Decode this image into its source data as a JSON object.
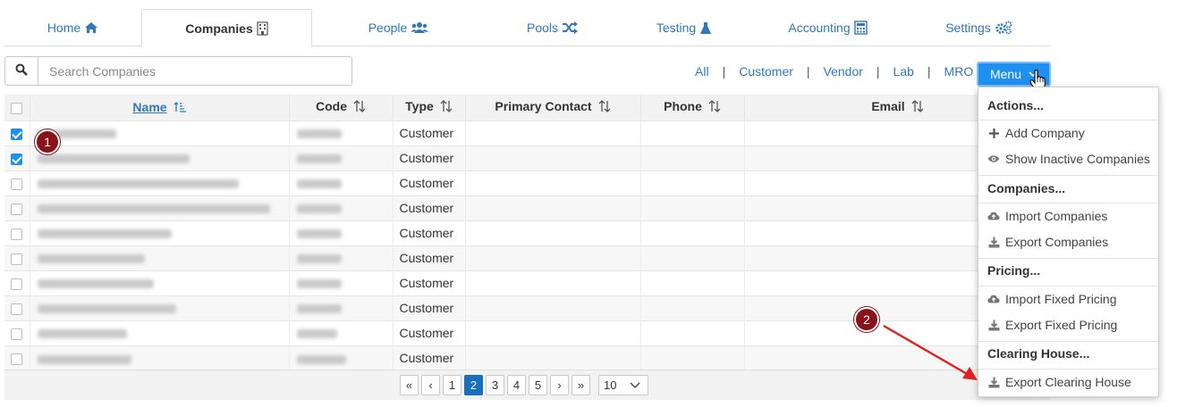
{
  "tabs": [
    {
      "label": "Home",
      "icon": "home-icon"
    },
    {
      "label": "Companies",
      "icon": "building-icon"
    },
    {
      "label": "People",
      "icon": "people-icon"
    },
    {
      "label": "Pools",
      "icon": "shuffle-icon"
    },
    {
      "label": "Testing",
      "icon": "flask-icon"
    },
    {
      "label": "Accounting",
      "icon": "calculator-icon"
    },
    {
      "label": "Settings",
      "icon": "cogs-icon"
    }
  ],
  "active_tab": "Companies",
  "search": {
    "placeholder": "Search Companies",
    "value": ""
  },
  "filters": [
    "All",
    "Customer",
    "Vendor",
    "Lab",
    "MRO"
  ],
  "menu_button": {
    "label": "Menu"
  },
  "table": {
    "columns": [
      "Name",
      "Code",
      "Type",
      "Primary Contact",
      "Phone",
      "Email"
    ],
    "sorted_column": "Name",
    "rows": [
      {
        "checked": true,
        "type": "Customer"
      },
      {
        "checked": true,
        "type": "Customer"
      },
      {
        "checked": false,
        "type": "Customer"
      },
      {
        "checked": false,
        "type": "Customer"
      },
      {
        "checked": false,
        "type": "Customer"
      },
      {
        "checked": false,
        "type": "Customer"
      },
      {
        "checked": false,
        "type": "Customer"
      },
      {
        "checked": false,
        "type": "Customer"
      },
      {
        "checked": false,
        "type": "Customer"
      },
      {
        "checked": false,
        "type": "Customer"
      }
    ]
  },
  "pagination": {
    "first": "«",
    "prev": "‹",
    "pages": [
      "1",
      "2",
      "3",
      "4",
      "5"
    ],
    "current": "2",
    "next": "›",
    "last": "»",
    "page_size": "10"
  },
  "dropdown": {
    "sections": [
      {
        "heading": "Actions...",
        "items": [
          {
            "label": "Add Company",
            "icon": "plus-icon"
          },
          {
            "label": "Show Inactive Companies",
            "icon": "eye-icon"
          }
        ]
      },
      {
        "heading": "Companies...",
        "items": [
          {
            "label": "Import Companies",
            "icon": "cloud-upload-icon"
          },
          {
            "label": "Export Companies",
            "icon": "download-icon"
          }
        ]
      },
      {
        "heading": "Pricing...",
        "items": [
          {
            "label": "Import Fixed Pricing",
            "icon": "cloud-upload-icon"
          },
          {
            "label": "Export Fixed Pricing",
            "icon": "download-icon"
          }
        ]
      },
      {
        "heading": "Clearing House...",
        "items": [
          {
            "label": "Export Clearing House",
            "icon": "download-icon"
          }
        ]
      }
    ]
  },
  "callouts": [
    "1",
    "2"
  ],
  "colors": {
    "accent": "#1f8ff0",
    "link": "#2e78c0",
    "callout": "#8b1219",
    "arrow": "#e02020"
  }
}
